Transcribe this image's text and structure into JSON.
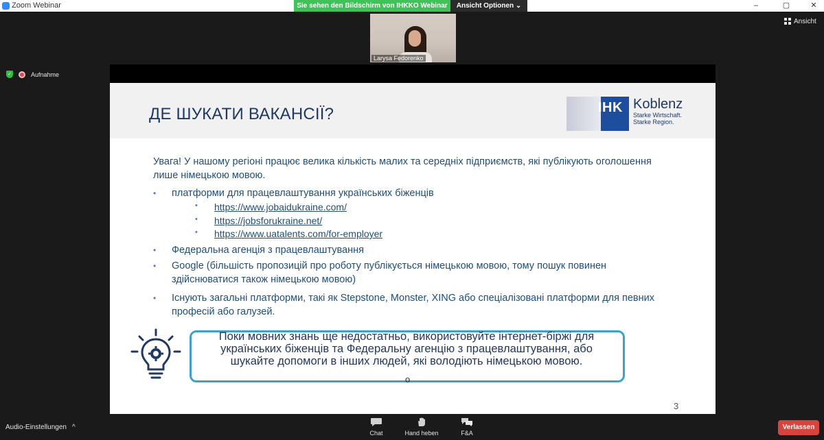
{
  "window": {
    "title": "Zoom Webinar",
    "banner": "Sie sehen den Bildschirm von IHKKO Webinar",
    "view_options": "Ansicht Optionen",
    "view_button": "Ansicht",
    "controls": [
      "–",
      "▢",
      "✕"
    ]
  },
  "participant": {
    "name": "Larysa Fedorenko"
  },
  "recording": {
    "label": "Aufnahme"
  },
  "slide": {
    "title": "ДЕ ШУКАТИ ВАКАНСІЇ?",
    "logo": {
      "mark": "IHK",
      "city": "Koblenz",
      "tagline1": "Starke Wirtschaft.",
      "tagline2": "Starke Region."
    },
    "intro": "Увага! У нашому регіоні працює велика кількість малих та середніх підприємств, які публікують оголошення лише німецькою мовою.",
    "bullets": [
      "платформи для працевлаштування українських біженців",
      "Федеральна агенція з працевлаштування",
      "Google (більшість пропозицій про роботу публікується німецькою мовою, тому пошук  повинен здійснюватися також німецькою мовою)",
      "Існують загальні платформи, такі як Stepstone, Monster, XING або спеціалізовані платформи для певних професій або галузей."
    ],
    "links": [
      "https://www.jobaidukraine.com/",
      "https://jobsforukraine.net/",
      "https://www.uatalents.com/for-employer"
    ],
    "callout": "Поки мовних знань ще недостатньо, використовуйте інтернет-біржі для українських біженців та Федеральну агенцію з працевлаштування, або шукайте допомоги в інших людей, які володіють німецькою мовою.",
    "callout_tail": "о",
    "page_number": "3"
  },
  "toolbar": {
    "audio": "Audio-Einstellungen",
    "audio_caret": "^",
    "chat": "Chat",
    "hand": "Hand heben",
    "qa": "F&A",
    "leave": "Verlassen"
  },
  "icons": {
    "bulb": "lightbulb-gear-icon",
    "chat": "chat-icon",
    "hand": "hand-icon",
    "qa": "qa-icon",
    "shield": "shield-icon"
  },
  "colors": {
    "banner": "#3fc257",
    "title": "#1f3864",
    "callout_border": "#3aa3c9",
    "ihk_blue": "#1d4e9e",
    "leave": "#d7443d"
  }
}
